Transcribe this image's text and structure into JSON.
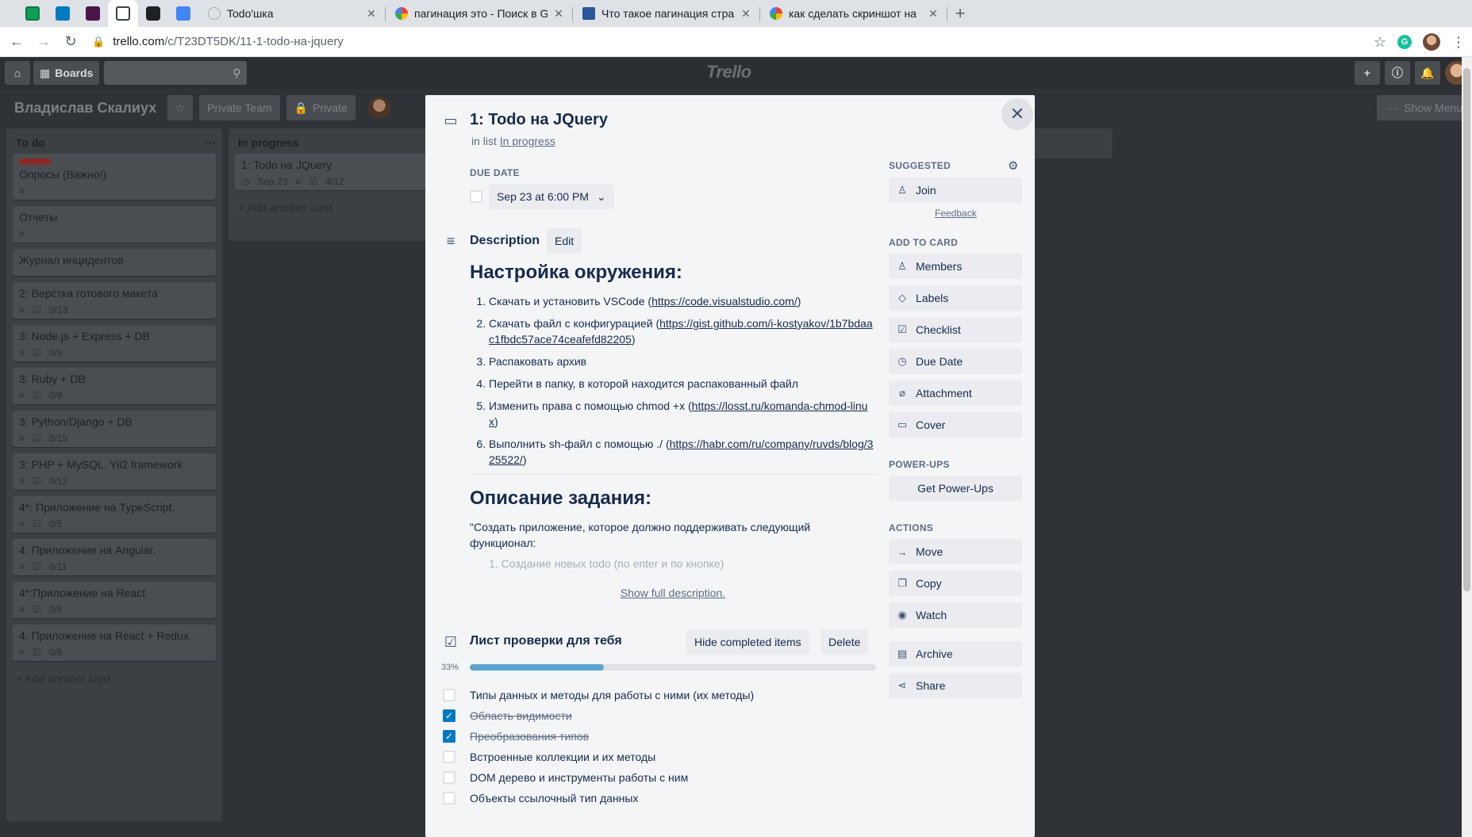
{
  "browser": {
    "tabs": [
      {
        "title": "Todo'шка",
        "favicon_color": "#4caf50"
      },
      {
        "title": "пагинация это - Поиск в Google",
        "favicon_color": "#4285f4"
      },
      {
        "title": "Что такое пагинация страницы",
        "favicon_color": "#2b579a"
      },
      {
        "title": "как сделать скриншот на",
        "favicon_color": "#4285f4"
      }
    ],
    "url_host": "trello.com",
    "url_path": "/c/T23DT5DK/11-1-todo-на-jquery",
    "grammarly_letter": "G"
  },
  "trello": {
    "boards_label": "Boards",
    "logo": "Trello",
    "board_title": "Владислав Скалиух",
    "team_label": "Private Team",
    "visibility_label": "Private",
    "show_menu_label": "Show Menu"
  },
  "lists": {
    "todo": {
      "title": "To do",
      "menu": "···",
      "cards": [
        {
          "title": "Опросы (Важно!)",
          "label": true,
          "desc": true
        },
        {
          "title": "Отчеты",
          "desc": true
        },
        {
          "title": "Журнал инцидентов"
        },
        {
          "title": "2: Верстка готового макета",
          "desc": true,
          "check": "0/13"
        },
        {
          "title": "3: Node.js + Express + DB",
          "desc": true,
          "check": "0/9"
        },
        {
          "title": "3: Ruby + DB",
          "desc": true,
          "check": "0/9"
        },
        {
          "title": "3: Python/Django + DB",
          "desc": true,
          "check": "0/15"
        },
        {
          "title": "3: PHP + MySQL. Yii2 framework",
          "desc": true,
          "check": "0/12"
        },
        {
          "title": "4*: Приложение на TypeScript.",
          "desc": true,
          "check": "0/5"
        },
        {
          "title": "4: Приложение на Angular.",
          "desc": true,
          "check": "0/11"
        },
        {
          "title": "4*:Приложение на React",
          "desc": true,
          "check": "0/8"
        },
        {
          "title": "4. Приложение на React + Redux",
          "desc": true,
          "check": "0/6"
        }
      ],
      "add_card": "Add another card"
    },
    "progress": {
      "title": "In progress",
      "card_title": "1: Todo на JQuery",
      "card_date": "Sep 23",
      "card_check": "4/12",
      "add_card": "Add another card"
    }
  },
  "modal": {
    "title": "1: Todo на JQuery",
    "in_list_prefix": "in list",
    "in_list_link": "In progress",
    "due_heading": "DUE DATE",
    "due_value": "Sep 23 at 6:00 PM",
    "description_heading": "Description",
    "edit_label": "Edit",
    "desc": {
      "h1": "Настройка окружения:",
      "steps": [
        {
          "text": "Скачать и установить VSCode (",
          "link": "https://code.visualstudio.com/",
          "after": ")"
        },
        {
          "text": "Скачать файл с конфигурацией (",
          "link": "https://gist.github.com/i-kostyakov/1b7bdaac1fbdc57ace74ceafefd82205",
          "after": ")"
        },
        {
          "text": "Распаковать архив",
          "link": "",
          "after": ""
        },
        {
          "text": "Перейти в папку, в которой находится распакованный файл",
          "link": "",
          "after": ""
        },
        {
          "text": "Изменить права с помощью chmod +x (",
          "link": "https://losst.ru/komanda-chmod-linux",
          "after": ")"
        },
        {
          "text": "Выполнить sh-файл с помощью ./ (",
          "link": "https://habr.com/ru/company/ruvds/blog/325522/",
          "after": ")"
        }
      ],
      "h2": "Описание задания:",
      "para": "\"Создать приложение, которое должно поддерживать следующий функционал:",
      "faded": "1. Создание новых todo (по enter и по кнопке)"
    },
    "show_full": "Show full description.",
    "checklist": {
      "title": "Лист проверки для тебя",
      "hide_label": "Hide completed items",
      "delete_label": "Delete",
      "percent_label": "33%",
      "percent": 33,
      "items": [
        {
          "text": "Типы данных и методы для работы с ними (их методы)",
          "done": false
        },
        {
          "text": "Область видимости",
          "done": true
        },
        {
          "text": "Преобразования типов",
          "done": true
        },
        {
          "text": "Встроенные коллекции и их методы",
          "done": false
        },
        {
          "text": "DOM дерево и инструменты работы с ним",
          "done": false
        },
        {
          "text": "Объекты ссылочный тип данных",
          "done": false
        }
      ]
    },
    "sidebar": {
      "suggested": "SUGGESTED",
      "join": "Join",
      "feedback": "Feedback",
      "add_to_card": "ADD TO CARD",
      "members": "Members",
      "labels": "Labels",
      "checklist": "Checklist",
      "due_date": "Due Date",
      "attachment": "Attachment",
      "cover": "Cover",
      "power_ups": "POWER-UPS",
      "get_power_ups": "Get Power-Ups",
      "actions": "ACTIONS",
      "move": "Move",
      "copy": "Copy",
      "watch": "Watch",
      "archive": "Archive",
      "share": "Share"
    }
  }
}
